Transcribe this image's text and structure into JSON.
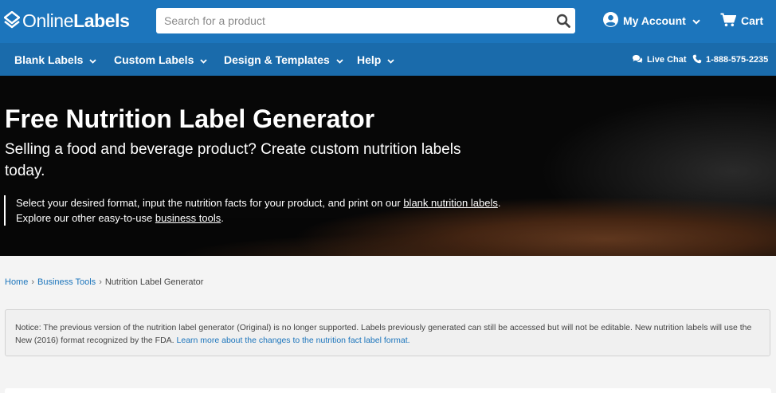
{
  "brand": {
    "logo_text_light": "Online",
    "logo_text_bold": "Labels"
  },
  "search": {
    "placeholder": "Search for a product",
    "value": ""
  },
  "header": {
    "account_label": "My Account",
    "cart_label": "Cart"
  },
  "nav": {
    "items": [
      {
        "label": "Blank Labels"
      },
      {
        "label": "Custom Labels"
      },
      {
        "label": "Design & Templates"
      },
      {
        "label": "Help"
      }
    ],
    "live_chat": "Live Chat",
    "phone": "1-888-575-2235"
  },
  "hero": {
    "title": "Free Nutrition Label Generator",
    "subtitle": "Selling a food and beverage product? Create custom nutrition labels today.",
    "note_part1": "Select your desired format, input the nutrition facts for your product, and print on our ",
    "note_link1": "blank nutrition labels",
    "note_part2": ".",
    "note_part3": "Explore our other easy-to-use ",
    "note_link2": "business tools",
    "note_part4": "."
  },
  "breadcrumb": {
    "home": "Home",
    "business_tools": "Business Tools",
    "current": "Nutrition Label Generator",
    "separator": "›"
  },
  "notice": {
    "text": "Notice: The previous version of the nutrition label generator (Original) is no longer supported. Labels previously generated can still be accessed but will not be editable. New nutrition labels will use the New (2016) format recognized by the FDA. ",
    "link": "Learn more about the changes to the nutrition fact label format."
  },
  "colors": {
    "header_blue": "#1c75bc",
    "nav_blue": "#1a6bab",
    "link_blue": "#1c75bc"
  }
}
